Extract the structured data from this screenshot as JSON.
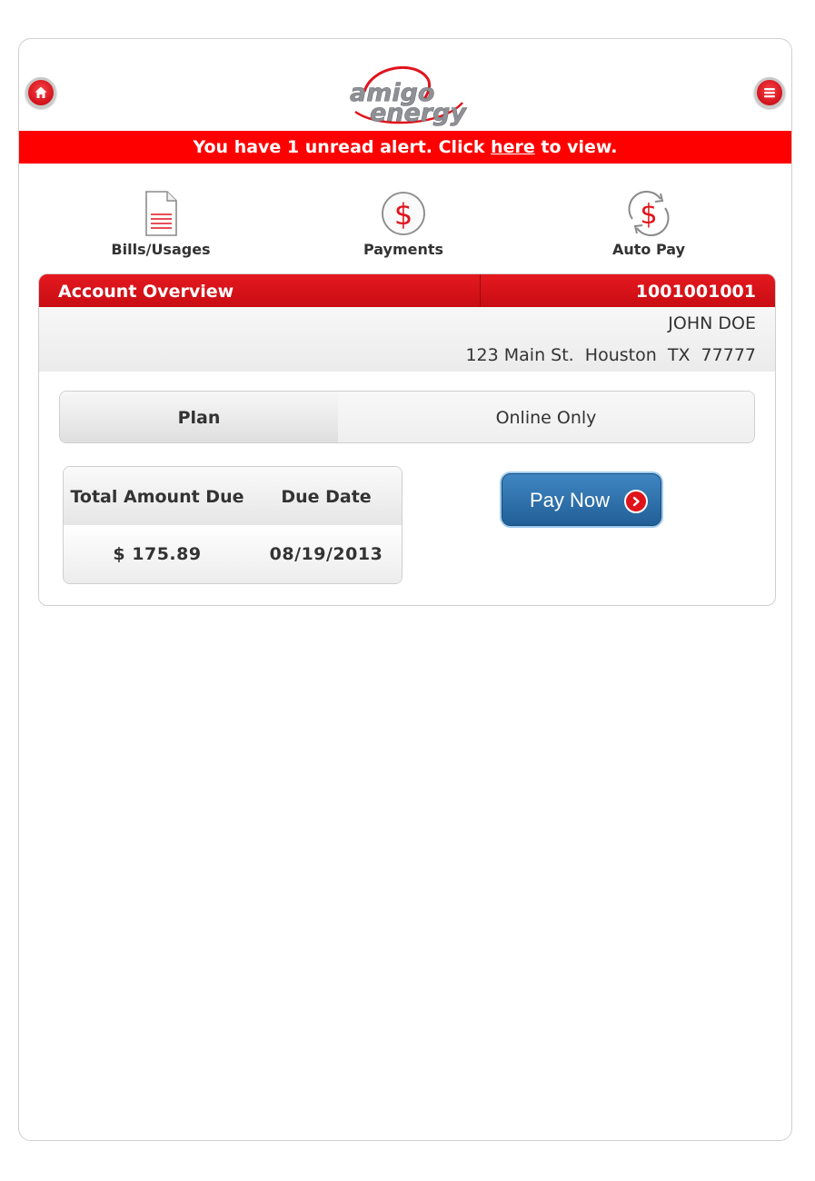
{
  "header": {
    "home_icon": "home-icon",
    "menu_icon": "menu-icon",
    "logo_line1": "amigo",
    "logo_line2": "energy"
  },
  "alert": {
    "prefix": "You have 1 unread alert. Click ",
    "link": "here",
    "suffix": " to view."
  },
  "nav": [
    {
      "label": "Bills/Usages",
      "icon": "document-icon"
    },
    {
      "label": "Payments",
      "icon": "dollar-icon"
    },
    {
      "label": "Auto Pay",
      "icon": "auto-pay-icon"
    }
  ],
  "account": {
    "title": "Account Overview",
    "number": "1001001001",
    "customer_name": "JOHN DOE",
    "address": "123 Main St.  Houston  TX  77777"
  },
  "plan": {
    "label": "Plan",
    "value": "Online Only"
  },
  "due": {
    "amount_header": "Total Amount Due",
    "date_header": "Due Date",
    "amount": "$ 175.89",
    "date": "08/19/2013"
  },
  "pay_button": {
    "label": "Pay Now",
    "icon": "chevron-right-icon"
  },
  "colors": {
    "brand_red": "#e4191f",
    "alert_red": "#ff0000",
    "button_blue": "#2f72ad"
  }
}
